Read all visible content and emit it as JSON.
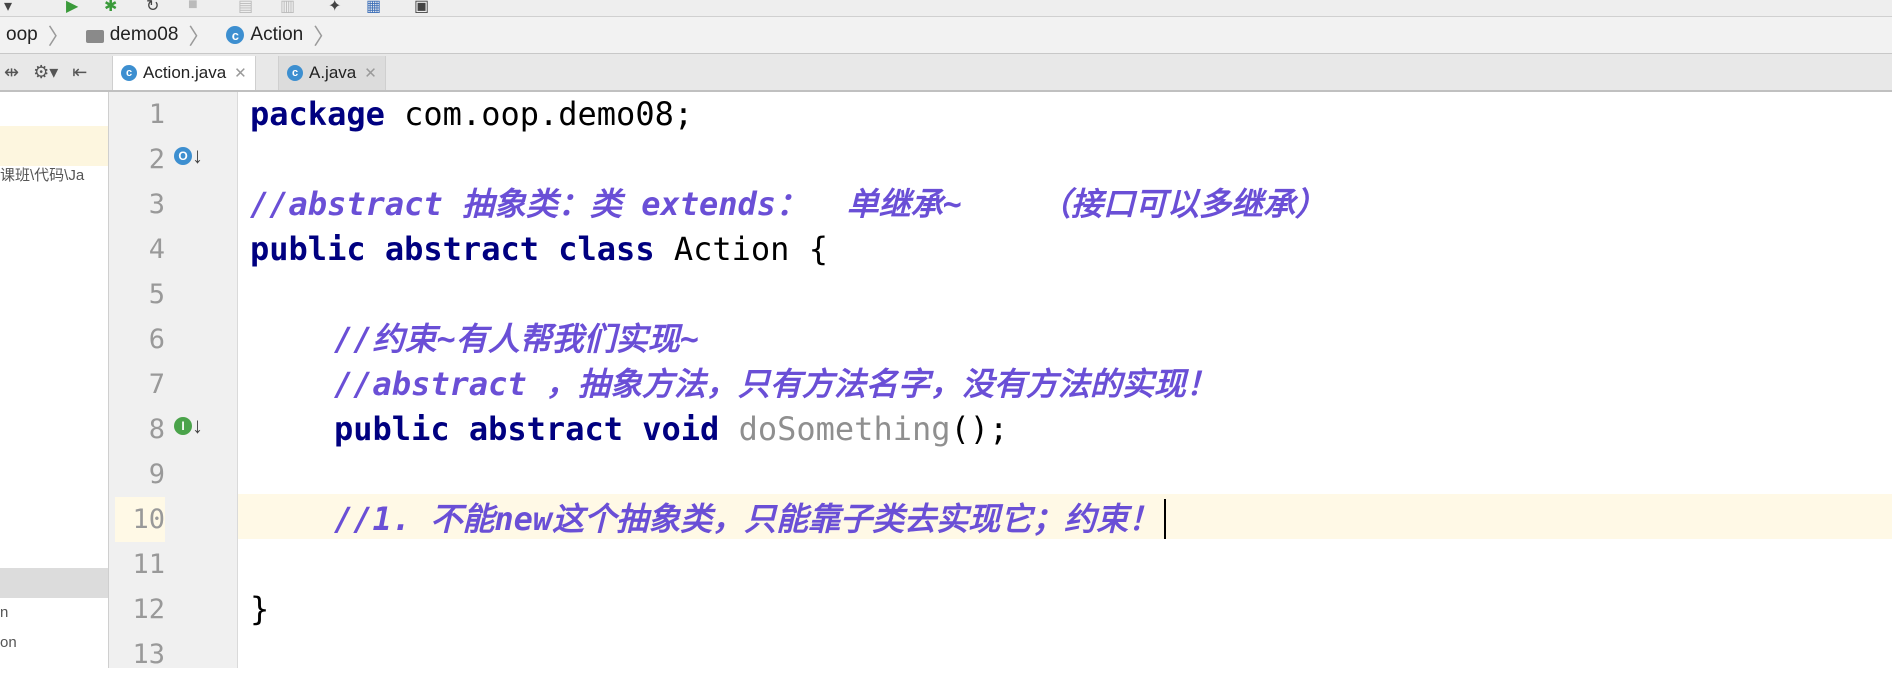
{
  "breadcrumb": {
    "items": [
      "oop",
      "demo08",
      "Action"
    ]
  },
  "tabs": [
    {
      "label": "Action.java",
      "icon": "c",
      "active": true
    },
    {
      "label": "A.java",
      "icon": "c",
      "active": false
    }
  ],
  "sidebar": {
    "path_fragment": "课班\\代码\\Ja",
    "item_a": "n",
    "item_b": "on"
  },
  "editor": {
    "line_numbers": [
      "1",
      "2",
      "3",
      "4",
      "5",
      "6",
      "7",
      "8",
      "9",
      "10",
      "11",
      "12",
      "13"
    ],
    "code": {
      "l1_kw": "package",
      "l1_rest": " com.oop.demo08;",
      "l3_comment": "//abstract 抽象类：类 extends：  单继承~    （接口可以多继承）",
      "l4_kw": "public abstract class",
      "l4_rest": " Action {",
      "l6_comment": "//约束~有人帮我们实现~",
      "l7_comment": "//abstract ，抽象方法，只有方法名字，没有方法的实现！",
      "l8_kw": "public abstract void",
      "l8_method": "doSomething",
      "l8_rest": "();",
      "l10_comment": "//1. 不能new这个抽象类，只能靠子类去实现它；约束！",
      "l12_text": "}"
    },
    "gutter_marks": {
      "line4": {
        "icon": "O",
        "color": "#3d8fd0"
      },
      "line8": {
        "icon": "I",
        "color": "#4aa34a"
      }
    }
  },
  "colors": {
    "keyword": "#000080",
    "comment": "#6a4fd6",
    "unused_method": "#8f8f8f",
    "current_line": "#fff9e6"
  }
}
